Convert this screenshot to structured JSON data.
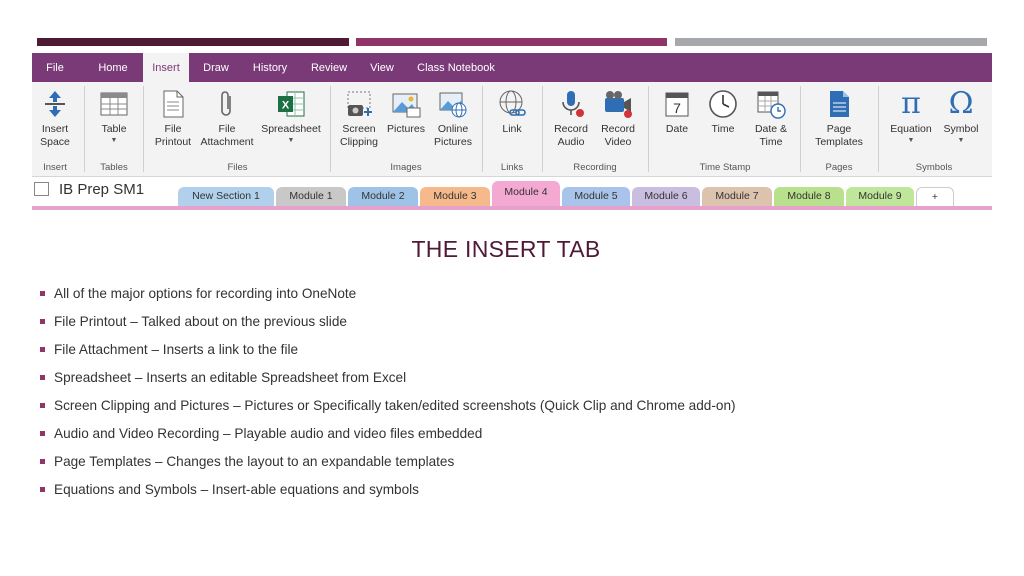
{
  "menu_tabs": [
    "File",
    "Home",
    "Insert",
    "Draw",
    "History",
    "Review",
    "View",
    "Class Notebook"
  ],
  "active_tab": "Insert",
  "ribbon": {
    "buttons": {
      "insert_space": "Insert\nSpace",
      "table": "Table",
      "file_printout": "File\nPrintout",
      "file_attachment": "File\nAttachment",
      "spreadsheet": "Spreadsheet",
      "screen_clipping": "Screen\nClipping",
      "pictures": "Pictures",
      "online_pictures": "Online\nPictures",
      "link": "Link",
      "record_audio": "Record\nAudio",
      "record_video": "Record\nVideo",
      "date": "Date",
      "time": "Time",
      "date_time": "Date &\nTime",
      "page_templates": "Page\nTemplates",
      "equation": "Equation",
      "symbol": "Symbol"
    },
    "groups": {
      "insert": "Insert",
      "tables": "Tables",
      "files": "Files",
      "images": "Images",
      "links": "Links",
      "recording": "Recording",
      "time_stamp": "Time Stamp",
      "pages": "Pages",
      "symbols": "Symbols"
    },
    "icons": {
      "equation_glyph": "π",
      "symbol_glyph": "Ω",
      "date_glyph": "7"
    }
  },
  "notebook": {
    "name": "IB Prep SM1",
    "sections": [
      "New Section 1",
      "Module 1",
      "Module 2",
      "Module 3",
      "Module 4",
      "Module 5",
      "Module 6",
      "Module 7",
      "Module 8",
      "Module 9"
    ],
    "active_section": "Module 4",
    "add_tab_label": "+"
  },
  "colors": {
    "menubar": "#7a3a78",
    "title": "#4e1a36",
    "bullet": "#8f3567",
    "section_tabs": [
      "#b0d0ec",
      "#c8c8c8",
      "#9fc3e6",
      "#f6b98b",
      "#f4a9d2",
      "#a9c4ea",
      "#c9bedf",
      "#dcc3ae",
      "#b9e08d",
      "#bfe69a"
    ]
  },
  "slide": {
    "title": "THE INSERT TAB",
    "bullets": [
      "All of the major options for recording into OneNote",
      "File Printout – Talked about on the previous slide",
      "File Attachment – Inserts a link to the file",
      "Spreadsheet – Inserts an editable Spreadsheet from Excel",
      "Screen Clipping and Pictures – Pictures or Specifically taken/edited screenshots (Quick Clip and Chrome add-on)",
      "Audio and Video Recording – Playable audio and video files embedded",
      "Page Templates – Changes the layout to an expandable templates",
      "Equations and Symbols – Insert-able equations and symbols"
    ]
  }
}
